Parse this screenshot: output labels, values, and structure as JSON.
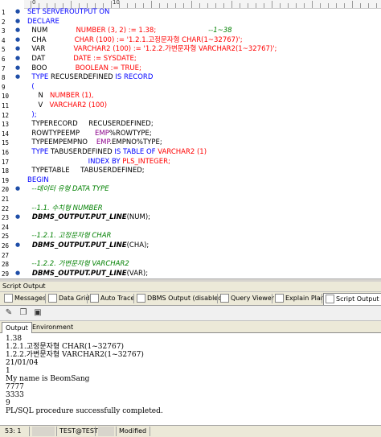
{
  "editor": {
    "ruler_marks": [
      "0",
      "10"
    ],
    "lines": [
      {
        "n": "1",
        "bm": "●",
        "fold": "",
        "segs": [
          [
            "kw",
            "SET SERVEROUTPUT ON"
          ]
        ]
      },
      {
        "n": "2",
        "bm": "●",
        "fold": "",
        "segs": [
          [
            "kw",
            "DECLARE"
          ]
        ]
      },
      {
        "n": "3",
        "bm": "●",
        "fold": "",
        "segs": [
          [
            "",
            "  NUM             "
          ],
          [
            "str",
            "NUMBER (3, 2) := 1.38;"
          ],
          [
            "",
            "                        "
          ],
          [
            "cm",
            "--1~38"
          ]
        ]
      },
      {
        "n": "4",
        "bm": "●",
        "fold": "",
        "segs": [
          [
            "",
            "  CHA             "
          ],
          [
            "str",
            "CHAR (100) := '1.2.1.고정문자형 CHAR(1~32767)';"
          ]
        ]
      },
      {
        "n": "5",
        "bm": "●",
        "fold": "",
        "segs": [
          [
            "",
            "  VAR             "
          ],
          [
            "str",
            "VARCHAR2 (100) := '1.2.2.가변문자형 VARCHAR2(1~32767)';"
          ]
        ]
      },
      {
        "n": "6",
        "bm": "●",
        "fold": "",
        "segs": [
          [
            "",
            "  DAT             "
          ],
          [
            "str",
            "DATE := SYSDATE;"
          ]
        ]
      },
      {
        "n": "7",
        "bm": "●",
        "fold": "",
        "segs": [
          [
            "",
            "  BOO             "
          ],
          [
            "str",
            "BOOLEAN := TRUE;"
          ]
        ]
      },
      {
        "n": "8",
        "bm": "●",
        "fold": "",
        "segs": [
          [
            "kw",
            "  TYPE "
          ],
          [
            "",
            "RECUSERDEFINED "
          ],
          [
            "kw",
            "IS RECORD"
          ]
        ]
      },
      {
        "n": "9",
        "bm": "",
        "fold": "",
        "segs": [
          [
            "kw",
            "  ("
          ]
        ]
      },
      {
        "n": "10",
        "bm": "",
        "fold": "",
        "segs": [
          [
            "",
            "     N   "
          ],
          [
            "str",
            "NUMBER (1),"
          ]
        ]
      },
      {
        "n": "11",
        "bm": "",
        "fold": "",
        "segs": [
          [
            "",
            "     V   "
          ],
          [
            "str",
            "VARCHAR2 (100)"
          ]
        ]
      },
      {
        "n": "12",
        "bm": "",
        "fold": "",
        "segs": [
          [
            "kw",
            "  );"
          ]
        ]
      },
      {
        "n": "13",
        "bm": "",
        "fold": "",
        "segs": [
          [
            "",
            "  TYPERECORD     RECUSERDEFINED;"
          ]
        ]
      },
      {
        "n": "14",
        "bm": "",
        "fold": "",
        "segs": [
          [
            "",
            "  ROWTYPEEMP       "
          ],
          [
            "fn",
            "EMP"
          ],
          [
            "",
            "%ROWTYPE;"
          ]
        ]
      },
      {
        "n": "15",
        "bm": "",
        "fold": "",
        "segs": [
          [
            "",
            "  TYPEEMPEMPNO    "
          ],
          [
            "fn",
            "EMP"
          ],
          [
            "",
            ".EMPNO%TYPE;"
          ]
        ]
      },
      {
        "n": "16",
        "bm": "",
        "fold": "",
        "segs": [
          [
            "kw",
            "  TYPE "
          ],
          [
            "",
            "TABUSERDEFINED "
          ],
          [
            "kw",
            "IS TABLE OF "
          ],
          [
            "str",
            "VARCHAR2 (1)"
          ]
        ]
      },
      {
        "n": "17",
        "bm": "",
        "fold": "",
        "segs": [
          [
            "",
            "                            "
          ],
          [
            "kw",
            "INDEX BY "
          ],
          [
            "str",
            "PLS_INTEGER;"
          ]
        ]
      },
      {
        "n": "18",
        "bm": "",
        "fold": "",
        "segs": [
          [
            "",
            "  TYPETABLE     TABUSERDEFINED;"
          ]
        ]
      },
      {
        "n": "19",
        "bm": "",
        "fold": "",
        "segs": [
          [
            "kw",
            "BEGIN"
          ]
        ]
      },
      {
        "n": "20",
        "bm": "●",
        "fold": "",
        "segs": [
          [
            "cm",
            "  --데이터 유형 DATA TYPE"
          ]
        ]
      },
      {
        "n": "21",
        "bm": "",
        "fold": "",
        "segs": [
          [
            "",
            ""
          ]
        ]
      },
      {
        "n": "22",
        "bm": "",
        "fold": "",
        "segs": [
          [
            "cm",
            "  --1.1. 수치형 NUMBER"
          ]
        ]
      },
      {
        "n": "23",
        "bm": "●",
        "fold": "",
        "segs": [
          [
            "bold",
            "  DBMS_OUTPUT.PUT_LINE"
          ],
          [
            "",
            "(NUM);"
          ]
        ]
      },
      {
        "n": "24",
        "bm": "",
        "fold": "",
        "segs": [
          [
            "",
            ""
          ]
        ]
      },
      {
        "n": "25",
        "bm": "",
        "fold": "",
        "segs": [
          [
            "cm",
            "  --1.2.1. 고정문자형 CHAR"
          ]
        ]
      },
      {
        "n": "26",
        "bm": "●",
        "fold": "",
        "segs": [
          [
            "bold",
            "  DBMS_OUTPUT.PUT_LINE"
          ],
          [
            "",
            "(CHA);"
          ]
        ]
      },
      {
        "n": "27",
        "bm": "",
        "fold": "",
        "segs": [
          [
            "",
            ""
          ]
        ]
      },
      {
        "n": "28",
        "bm": "",
        "fold": "",
        "segs": [
          [
            "cm",
            "  --1.2.2. 가변문자형 VARCHAR2"
          ]
        ]
      },
      {
        "n": "29",
        "bm": "●",
        "fold": "",
        "segs": [
          [
            "bold",
            "  DBMS_OUTPUT.PUT_LINE"
          ],
          [
            "",
            "(VAR);"
          ]
        ]
      }
    ]
  },
  "panel": {
    "title": "Script Output",
    "tabs": [
      {
        "label": "Messages",
        "icon": "messages-icon",
        "active": false
      },
      {
        "label": "Data Grid",
        "icon": "data-grid-icon",
        "active": false
      },
      {
        "label": "Auto Trace",
        "icon": "auto-trace-icon",
        "active": false
      },
      {
        "label": "DBMS Output (disabled)",
        "icon": "dbms-output-icon",
        "active": false
      },
      {
        "label": "Query Viewer",
        "icon": "query-viewer-icon",
        "active": false
      },
      {
        "label": "Explain Plan",
        "icon": "explain-plan-icon",
        "active": false
      },
      {
        "label": "Script Output",
        "icon": "script-output-icon",
        "active": true
      }
    ],
    "toolbar": [
      "clear-icon",
      "copy-icon",
      "save-icon"
    ],
    "subtabs": [
      {
        "label": "Output",
        "active": true
      },
      {
        "label": "Environment",
        "active": false
      }
    ],
    "output_lines": [
      "1.38",
      "1.2.1.고정문자형 CHAR(1~32767)",
      "1.2.2.가변문자형 VARCHAR2(1~32767)",
      "21/01/04",
      "1",
      "My name is BeomSang",
      "7777",
      "3333",
      "9",
      "PL/SQL procedure successfully completed."
    ]
  },
  "status": {
    "position": "53: 1",
    "connection": "TEST@TEST",
    "state": "Modified"
  }
}
